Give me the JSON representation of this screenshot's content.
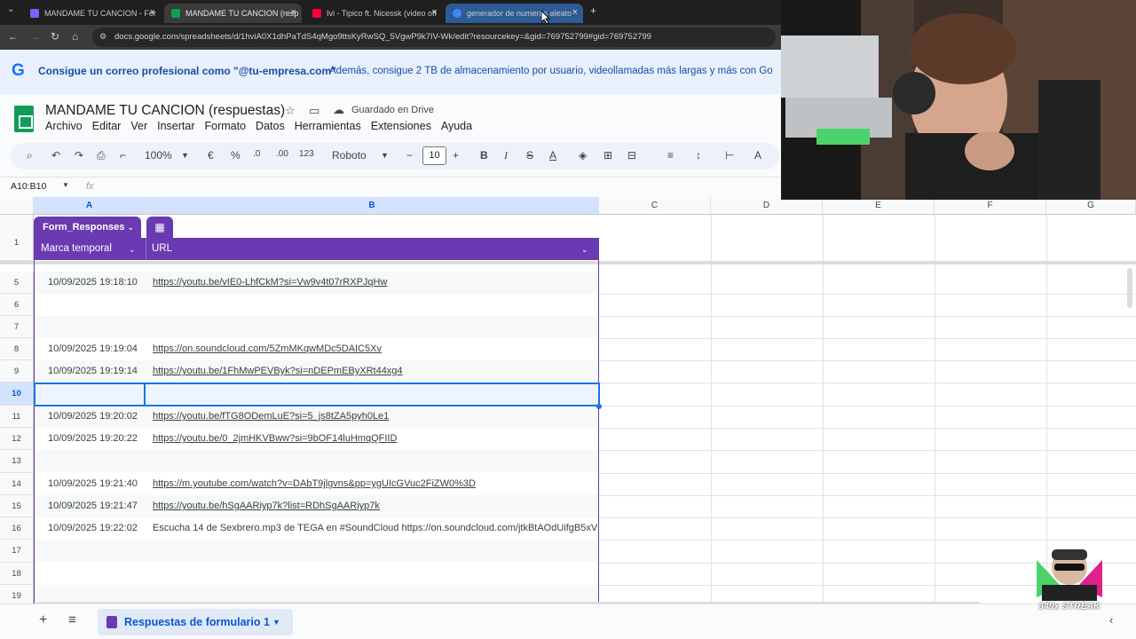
{
  "browser": {
    "tabs": [
      {
        "title": "MANDAME TU CANCION - For",
        "color": "#7b61ff"
      },
      {
        "title": "MANDAME TU CANCION (resp",
        "color": "#0f9d58"
      },
      {
        "title": "Ivi - Tipico ft. Nicessk (video ofi",
        "color": "#ff0033"
      },
      {
        "title": "generador de numeros aleato",
        "color": "#4285f4"
      }
    ],
    "url": "docs.google.com/spreadsheets/d/1hviA0X1dhPaTdS4qMgo9ttsKyRwSQ_5VgwP9k7IV-Wk/edit?resourcekey=&gid=769752799#gid=769752799"
  },
  "banner": {
    "logo": "G",
    "bold": "Consigue un correo profesional como \"@tu-empresa.com\"",
    "text": "Además, consigue 2 TB de almacenamiento por usuario, videollamadas más largas y más con Go"
  },
  "doc": {
    "title": "MANDAME TU CANCION (respuestas)",
    "save_state": "Guardado en Drive",
    "menus": [
      "Archivo",
      "Editar",
      "Ver",
      "Insertar",
      "Formato",
      "Datos",
      "Herramientas",
      "Extensiones",
      "Ayuda"
    ]
  },
  "toolbar": {
    "zoom": "100%",
    "currency": "€",
    "percent": "%",
    "dec_less": ".0",
    "dec_more": ".00",
    "number_format": "123",
    "font": "Roboto",
    "font_size": "10",
    "bold": "B",
    "italic": "I",
    "strike": "S",
    "text_color": "A"
  },
  "formula_bar": {
    "name_box": "A10:B10",
    "fx": "fx"
  },
  "grid": {
    "columns": [
      "A",
      "B",
      "C",
      "D",
      "E",
      "F",
      "G"
    ],
    "rows": [
      "1",
      "5",
      "6",
      "7",
      "8",
      "9",
      "10",
      "11",
      "12",
      "13",
      "14",
      "15",
      "16",
      "17",
      "18",
      "19"
    ],
    "table_name": "Form_Responses",
    "headers": [
      "Marca temporal",
      "URL"
    ],
    "data": [
      {
        "row": "5",
        "ts": "10/09/2025 19:18:10",
        "url": "https://youtu.be/vIE0-LhfCkM?si=Vw9v4t07rRXPJqHw"
      },
      {
        "row": "6",
        "ts": "",
        "url": ""
      },
      {
        "row": "7",
        "ts": "",
        "url": ""
      },
      {
        "row": "8",
        "ts": "10/09/2025 19:19:04",
        "url": "https://on.soundcloud.com/5ZmMKqwMDc5DAIC5Xv"
      },
      {
        "row": "9",
        "ts": "10/09/2025 19:19:14",
        "url": "https://youtu.be/1FhMwPEVByk?si=nDEPmEByXRt44xg4"
      },
      {
        "row": "10",
        "ts": "",
        "url": ""
      },
      {
        "row": "11",
        "ts": "10/09/2025 19:20:02",
        "url": "https://youtu.be/fTG8ODemLuE?si=5_js8tZA5pyh0Le1"
      },
      {
        "row": "12",
        "ts": "10/09/2025 19:20:22",
        "url": "https://youtu.be/0_2jmHKVBww?si=9bOF14luHmqQFIID"
      },
      {
        "row": "13",
        "ts": "",
        "url": ""
      },
      {
        "row": "14",
        "ts": "10/09/2025 19:21:40",
        "url": "https://m.youtube.com/watch?v=DAbT9jlgvns&pp=ygUIcGVuc2FiZW0%3D"
      },
      {
        "row": "15",
        "ts": "10/09/2025 19:21:47",
        "url": "https://youtu.be/hSgAARiyp7k?list=RDhSgAARiyp7k"
      },
      {
        "row": "16",
        "ts": "10/09/2025 19:22:02",
        "text": "Escucha 14 de Sexbrero.mp3 de TEGA en #SoundCloud https://on.soundcloud.com/jtkBtAOdUifgB5xV"
      }
    ]
  },
  "sheet_tab": "Respuestas de formulario 1",
  "stream_badge": "349x STREAK",
  "colors": {
    "accent": "#6a3ab2",
    "selection": "#1a73e8",
    "sheets_green": "#0f9d58"
  }
}
